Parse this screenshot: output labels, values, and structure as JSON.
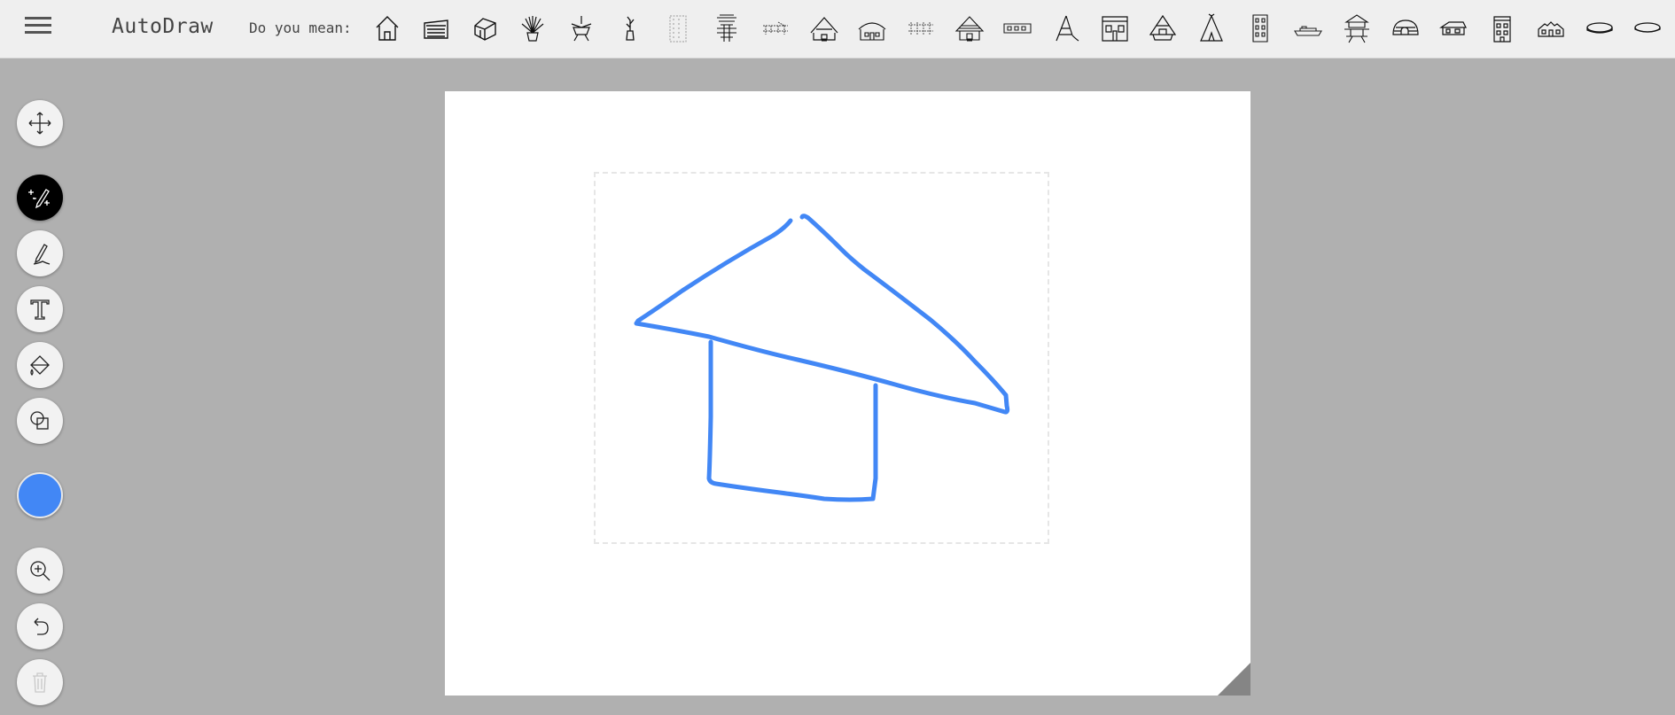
{
  "app": {
    "title": "AutoDraw"
  },
  "header": {
    "menu_icon": "hamburger-menu-icon",
    "suggest_label": "Do you mean:",
    "suggestions": [
      "house",
      "shed",
      "house-3d",
      "potted-plant",
      "hanging-plant",
      "vase",
      "building-tall",
      "lighthouse-tower",
      "bridge",
      "hut",
      "cottage",
      "fence",
      "thatched-hut",
      "train-car",
      "tent-pole",
      "storefront",
      "a-frame-house",
      "teepee",
      "apartment",
      "boat",
      "pagoda",
      "igloo",
      "small-house",
      "townhouse",
      "barn",
      "pool",
      "disc"
    ]
  },
  "colors": {
    "brush": "#4287f5",
    "background": "#b0b0b0",
    "topbar": "#efefef"
  },
  "tools": [
    {
      "name": "select-tool",
      "icon": "move-arrows-icon"
    },
    {
      "name": "autodraw-tool",
      "icon": "magic-pencil-icon",
      "active": true
    },
    {
      "name": "draw-tool",
      "icon": "pencil-icon"
    },
    {
      "name": "type-tool",
      "icon": "text-icon"
    },
    {
      "name": "fill-tool",
      "icon": "paint-bucket-icon"
    },
    {
      "name": "shape-tool",
      "icon": "shapes-icon"
    },
    {
      "name": "color-picker",
      "icon": "color-swatch-icon"
    },
    {
      "name": "zoom-tool",
      "icon": "zoom-in-icon"
    },
    {
      "name": "undo-tool",
      "icon": "undo-icon"
    },
    {
      "name": "delete-tool",
      "icon": "trash-icon",
      "disabled": true
    }
  ]
}
